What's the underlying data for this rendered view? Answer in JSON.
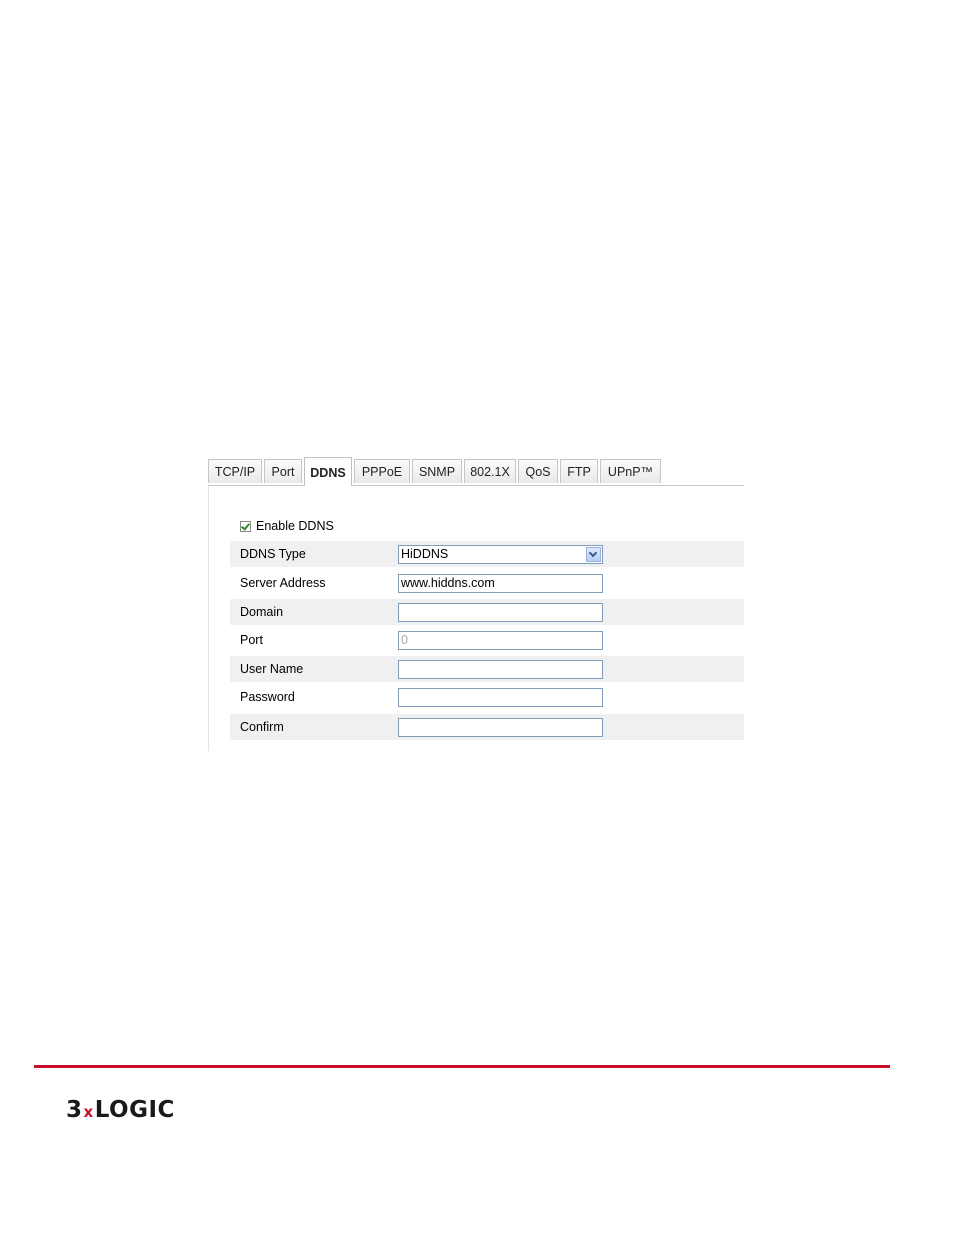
{
  "tabs": [
    {
      "label": "TCP/IP",
      "active": false
    },
    {
      "label": "Port",
      "active": false
    },
    {
      "label": "DDNS",
      "active": true
    },
    {
      "label": "PPPoE",
      "active": false
    },
    {
      "label": "SNMP",
      "active": false
    },
    {
      "label": "802.1X",
      "active": false
    },
    {
      "label": "QoS",
      "active": false
    },
    {
      "label": "FTP",
      "active": false
    },
    {
      "label": "UPnP™",
      "active": false
    }
  ],
  "form": {
    "enable_label": "Enable DDNS",
    "enable_checked": true,
    "ddns_type": {
      "label": "DDNS Type",
      "value": "HiDDNS"
    },
    "server_address": {
      "label": "Server Address",
      "value": "www.hiddns.com"
    },
    "domain": {
      "label": "Domain",
      "value": ""
    },
    "port": {
      "label": "Port",
      "value": "0"
    },
    "user_name": {
      "label": "User Name",
      "value": ""
    },
    "password": {
      "label": "Password",
      "value": ""
    },
    "confirm": {
      "label": "Confirm",
      "value": ""
    }
  },
  "footer": {
    "logo_prefix": "3",
    "logo_x": "x",
    "logo_suffix": "LOGIC",
    "accent_color": "#c8102e"
  }
}
